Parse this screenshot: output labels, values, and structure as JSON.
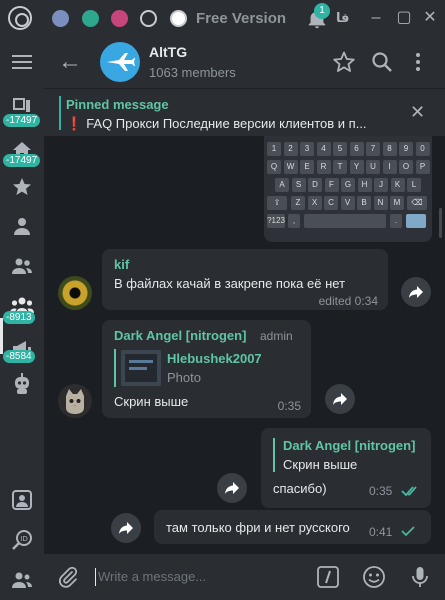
{
  "topbar": {
    "free_label": "Free Version",
    "notification_count": "1",
    "lang_label": "فا",
    "swatches": [
      "#7a8fbe",
      "#2fa78e",
      "#c6457a",
      "#2a2e33",
      "#ffffff"
    ]
  },
  "sidebar": {
    "badges": {
      "chats": "-17497",
      "home": "-17497",
      "groups": "-8913",
      "channels": "-8584"
    }
  },
  "chat": {
    "title": "AltTG",
    "subtitle": "1063 members"
  },
  "pinned": {
    "title": "Pinned message",
    "text": "FAQ  Прокси   Последние версии клиентов и п..."
  },
  "keyboard": {
    "row1": [
      "1",
      "2",
      "3",
      "4",
      "5",
      "6",
      "7",
      "8",
      "9",
      "0"
    ],
    "row2": [
      "Q",
      "W",
      "E",
      "R",
      "T",
      "Y",
      "U",
      "I",
      "O",
      "P"
    ],
    "row3": [
      "A",
      "S",
      "D",
      "F",
      "G",
      "H",
      "J",
      "K",
      "L"
    ],
    "row4": [
      "Z",
      "X",
      "C",
      "V",
      "B",
      "N",
      "M"
    ],
    "row5_left": "?123"
  },
  "messages": [
    {
      "author": "kif",
      "text": "В файлах качай в закрепе пока её нет",
      "time": "edited 0:34"
    },
    {
      "author": "Dark Angel [nitrogen]",
      "role": "admin",
      "reply_author": "Hlebushek2007",
      "reply_text": "Photo",
      "text": "Скрин выше",
      "time": "0:35"
    },
    {
      "reply_author": "Dark Angel [nitrogen]",
      "reply_text": "Скрин выше",
      "text": "спасибо)",
      "time": "0:35"
    },
    {
      "text": "там только фри и нет русского",
      "time": "0:41"
    }
  ],
  "composer": {
    "placeholder": "Write a message..."
  }
}
